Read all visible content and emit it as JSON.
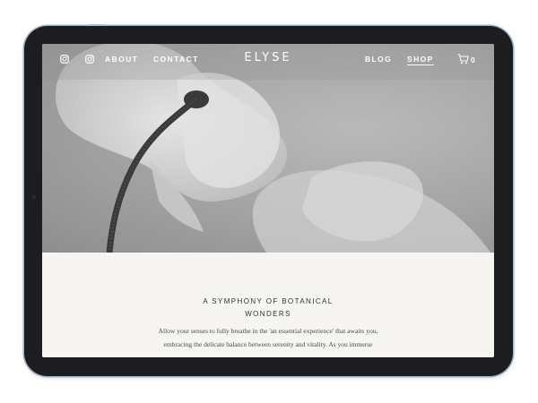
{
  "nav": {
    "about": "ABOUT",
    "contact": "CONTACT",
    "logo": "ELYSE",
    "blog": "BLOG",
    "shop": "SHOP",
    "cart_count": "0",
    "icons": [
      "instagram-icon",
      "instagram-icon",
      "cart-icon"
    ]
  },
  "content": {
    "heading_line1": "A SYMPHONY OF BOTANICAL",
    "heading_line2": "WONDERS",
    "body_line1": "Allow your senses to fully breathe in the 'an essential experience' that awaits you,",
    "body_line2": "embracing the delicate balance between serenity and vitality. As you immerse"
  },
  "colors": {
    "device_frame": "#1d1d1f",
    "content_bg": "#f6f5f2",
    "nav_text": "#ffffff"
  }
}
